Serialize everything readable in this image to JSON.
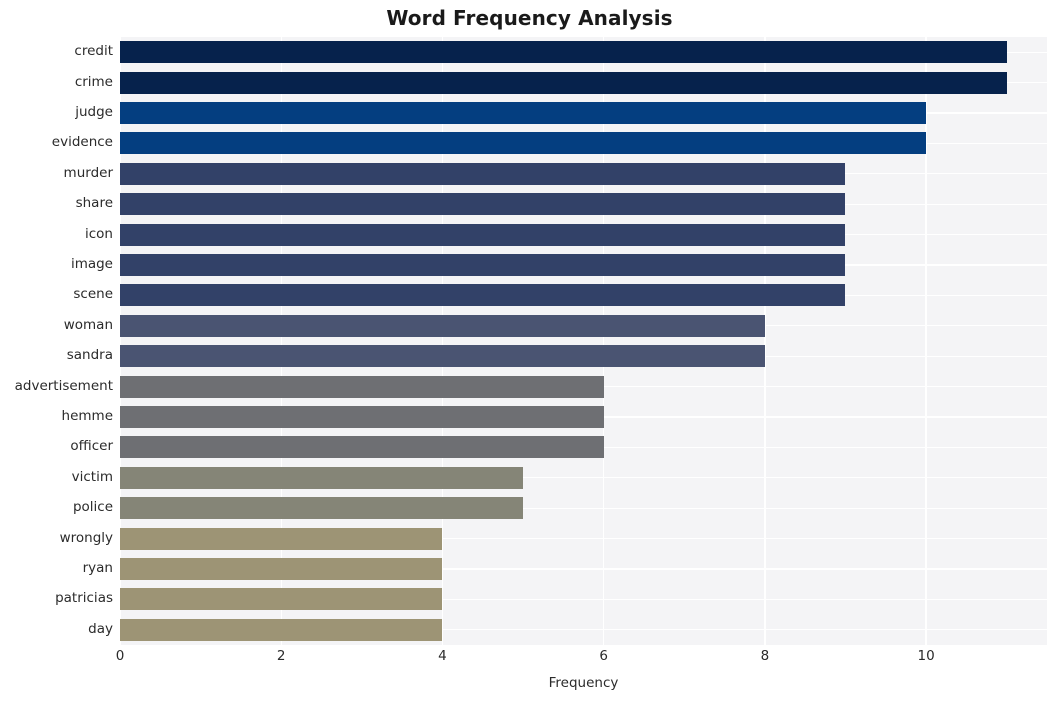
{
  "chart_data": {
    "type": "bar",
    "orientation": "horizontal",
    "title": "Word Frequency Analysis",
    "xlabel": "Frequency",
    "ylabel": "",
    "categories": [
      "credit",
      "crime",
      "judge",
      "evidence",
      "murder",
      "share",
      "icon",
      "image",
      "scene",
      "woman",
      "sandra",
      "advertisement",
      "hemme",
      "officer",
      "victim",
      "police",
      "wrongly",
      "ryan",
      "patricias",
      "day"
    ],
    "values": [
      11,
      11,
      10,
      10,
      9,
      9,
      9,
      9,
      9,
      8,
      8,
      6,
      6,
      6,
      5,
      5,
      4,
      4,
      4,
      4
    ],
    "bar_colors": [
      "#06224c",
      "#06224c",
      "#043e80",
      "#043e80",
      "#324168",
      "#324168",
      "#324168",
      "#324168",
      "#324168",
      "#4a5472",
      "#4a5472",
      "#6e6f73",
      "#6e6f73",
      "#6e6f73",
      "#858577",
      "#858577",
      "#9d9475",
      "#9d9475",
      "#9d9475",
      "#9d9475"
    ],
    "xticks": [
      0,
      2,
      4,
      6,
      8,
      10
    ],
    "xtick_labels": [
      "0",
      "2",
      "4",
      "6",
      "8",
      "10"
    ],
    "xlim": [
      0,
      11.5
    ],
    "grid": true,
    "legend": "none",
    "plot_background": "#f4f4f6",
    "grid_color": "#ffffff",
    "figure_background": "#ffffff",
    "title_color": "#1a1a1a",
    "tick_label_color": "#2b2b2b"
  }
}
